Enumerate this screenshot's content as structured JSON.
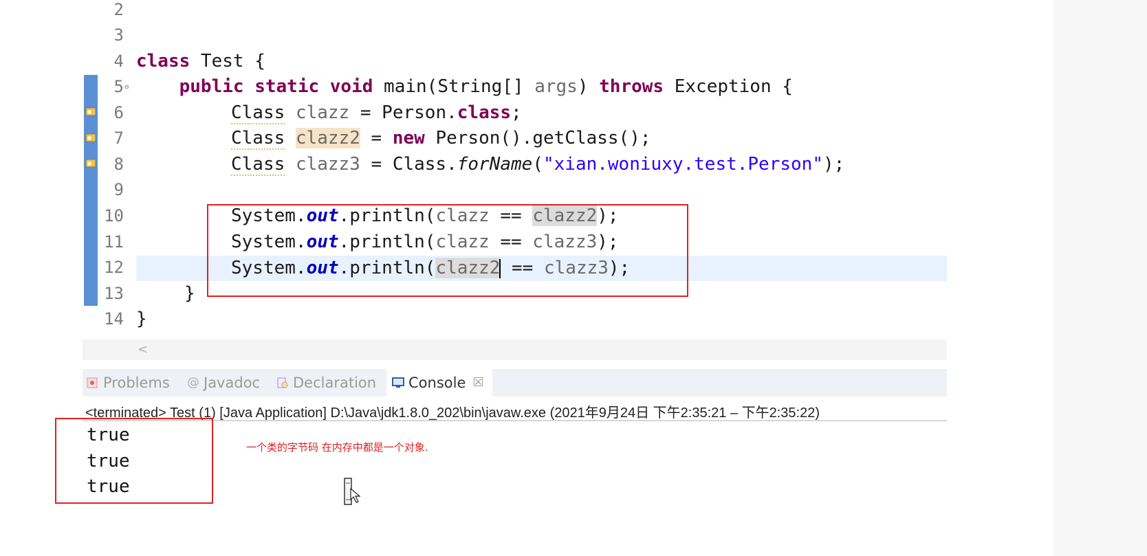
{
  "editor": {
    "line_numbers": [
      "2",
      "3",
      "4",
      "5",
      "6",
      "7",
      "8",
      "9",
      "10",
      "11",
      "12",
      "13",
      "14"
    ],
    "line4": {
      "kw": "class",
      "name": " Test {"
    },
    "line5": {
      "indent": "    ",
      "kw1": "public",
      "kw2": "static",
      "kw3": "void",
      "sig": " main(String[] ",
      "param": "args",
      "close": ") ",
      "kw4": "throws",
      "exc": " Exception {"
    },
    "line6": {
      "type": "Class",
      "var": "clazz",
      "eq": " = Person.",
      "kw": "class",
      "end": ";"
    },
    "line7": {
      "type": "Class",
      "var": "clazz2",
      "eq": " = ",
      "kw": "new",
      "rest": " Person().getClass();"
    },
    "line8": {
      "type": "Class",
      "var": "clazz3",
      "eq": " = Class.",
      "method": "forName",
      "open": "(",
      "str": "\"xian.woniuxy.test.Person\"",
      "end": ");"
    },
    "line10": {
      "sys": "System.",
      "fld": "out",
      "call": ".println(",
      "a": "clazz",
      "op": " == ",
      "b": "clazz2",
      "end": ");"
    },
    "line11": {
      "sys": "System.",
      "fld": "out",
      "call": ".println(",
      "a": "clazz",
      "op": " == ",
      "b": "clazz3",
      "end": ");"
    },
    "line12": {
      "sys": "System.",
      "fld": "out",
      "call": ".println(",
      "a": "clazz2",
      "op": " == ",
      "b": "clazz3",
      "end": ");"
    },
    "line13": "}",
    "line14": "}"
  },
  "tabs": [
    {
      "label": "Problems",
      "icon": "problems-icon"
    },
    {
      "label": "Javadoc",
      "icon": "javadoc-icon"
    },
    {
      "label": "Declaration",
      "icon": "declaration-icon"
    },
    {
      "label": "Console",
      "icon": "console-icon",
      "close": "☒"
    }
  ],
  "console": {
    "header": "<terminated> Test (1) [Java Application] D:\\Java\\jdk1.8.0_202\\bin\\javaw.exe  (2021年9月24日 下午2:35:21 – 下午2:35:22)",
    "output": [
      "true",
      "true",
      "true"
    ]
  },
  "annotation": "一个类的字节码 在内存中都是一个对象.",
  "colors": {
    "keyword": "#7f0055",
    "string": "#2a00ff",
    "field": "#0000c0",
    "annotation_red": "#e02020",
    "ruler_blue": "#5b8fd6"
  }
}
